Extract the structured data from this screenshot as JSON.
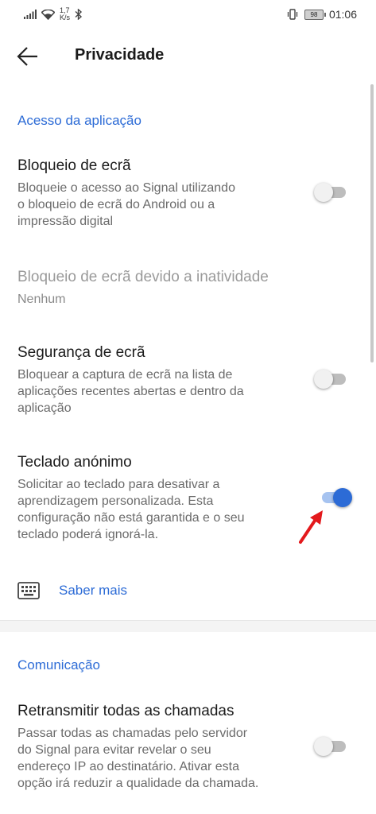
{
  "status_bar": {
    "speed_value": "1,7",
    "speed_unit": "K/s",
    "battery": "98",
    "time": "01:06"
  },
  "toolbar": {
    "title": "Privacidade"
  },
  "sections": {
    "app_access": {
      "header": "Acesso da aplicação",
      "screen_lock": {
        "title": "Bloqueio de ecrã",
        "summary": "Bloqueie o acesso ao Signal utilizando\no bloqueio de ecrã do Android ou a\nimpressão digital",
        "enabled": false
      },
      "inactivity_lock": {
        "title": "Bloqueio de ecrã devido a inatividade",
        "summary": "Nenhum"
      },
      "screen_security": {
        "title": "Segurança de ecrã",
        "summary": "Bloquear a captura de ecrã na lista de\naplicações recentes abertas e dentro da\naplicação",
        "enabled": false
      },
      "incognito_keyboard": {
        "title": "Teclado anónimo",
        "summary": "Solicitar ao teclado para desativar a\naprendizagem personalizada. Esta\nconfiguração não está garantida e o seu\nteclado poderá ignorá-la.",
        "enabled": true
      },
      "learn_more": "Saber mais"
    },
    "communication": {
      "header": "Comunicação",
      "relay_calls": {
        "title": "Retransmitir todas as chamadas",
        "summary": "Passar todas as chamadas pelo servidor\ndo Signal para evitar revelar o seu\nendereço IP ao destinatário. Ativar esta\nopção irá reduzir a qualidade da chamada.",
        "enabled": false
      }
    }
  },
  "colors": {
    "accent": "#2c6bd6",
    "annotation_arrow": "#e3191c"
  }
}
